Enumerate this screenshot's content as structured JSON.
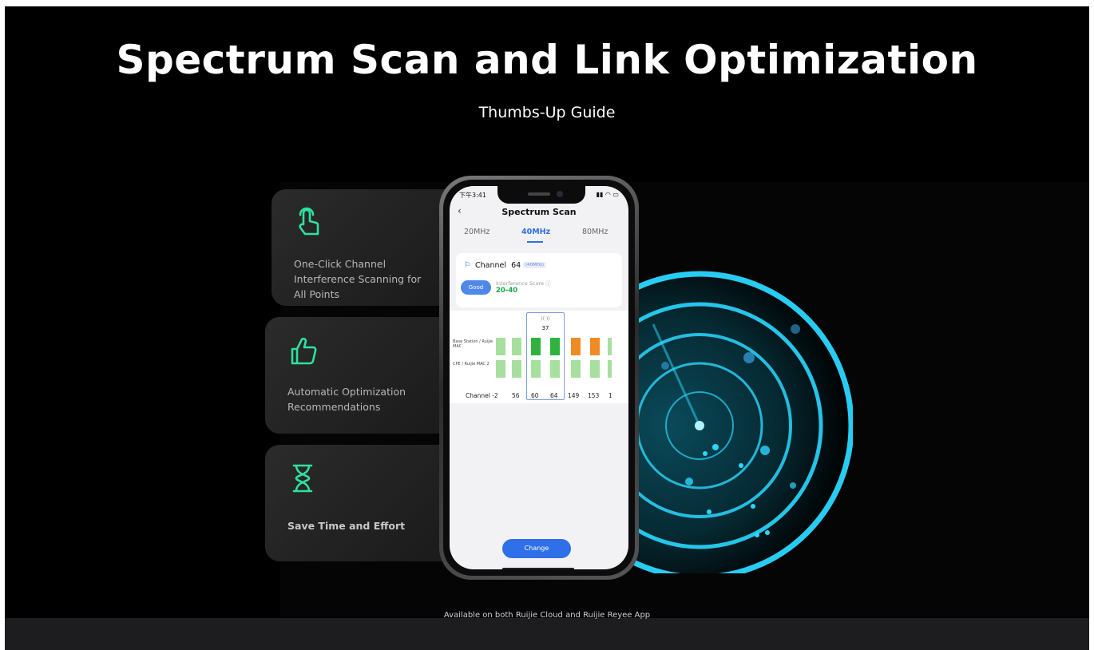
{
  "header": {
    "title": "Spectrum Scan and Link Optimization",
    "subtitle": "Thumbs-Up Guide"
  },
  "features": [
    {
      "icon": "tap-hand-icon",
      "label": "One-Click Channel Interference Scanning for All Points"
    },
    {
      "icon": "thumbs-up-icon",
      "label": "Automatic Optimization Recommendations"
    },
    {
      "icon": "hourglass-icon",
      "label": "Save Time and Effort"
    }
  ],
  "phone": {
    "status_time": "下午3:41",
    "screen_title": "Spectrum Scan",
    "tabs": [
      {
        "label": "20MHz",
        "active": false
      },
      {
        "label": "40MHz",
        "active": true
      },
      {
        "label": "80MHz",
        "active": false
      }
    ],
    "channel": {
      "label": "Channel",
      "number": "64",
      "badge": "(40MHz)",
      "status": "Good",
      "interference_label": "Interference Score ⓘ",
      "interference_value": "20-40"
    },
    "chart": {
      "row1_label": "Base Station / Ruijie MAC",
      "row2_label": "CPE / Ruijie MAC 2",
      "selected_value": "37",
      "channel_prefix": "Channel",
      "channels": [
        "-2",
        "56",
        "60",
        "64",
        "149",
        "153",
        "1"
      ]
    },
    "change_button": "Change"
  },
  "footer": "Available on both Ruijie Cloud and Ruijie Reyee App",
  "colors": {
    "accent": "#2f6fe8",
    "icon_green": "#2fe0a0",
    "radar_cyan": "#2ad7ff",
    "good_green": "#1aa84a",
    "bar_light_green": "#a6df9e",
    "bar_green": "#2fb23f",
    "bar_orange": "#f08a24"
  }
}
